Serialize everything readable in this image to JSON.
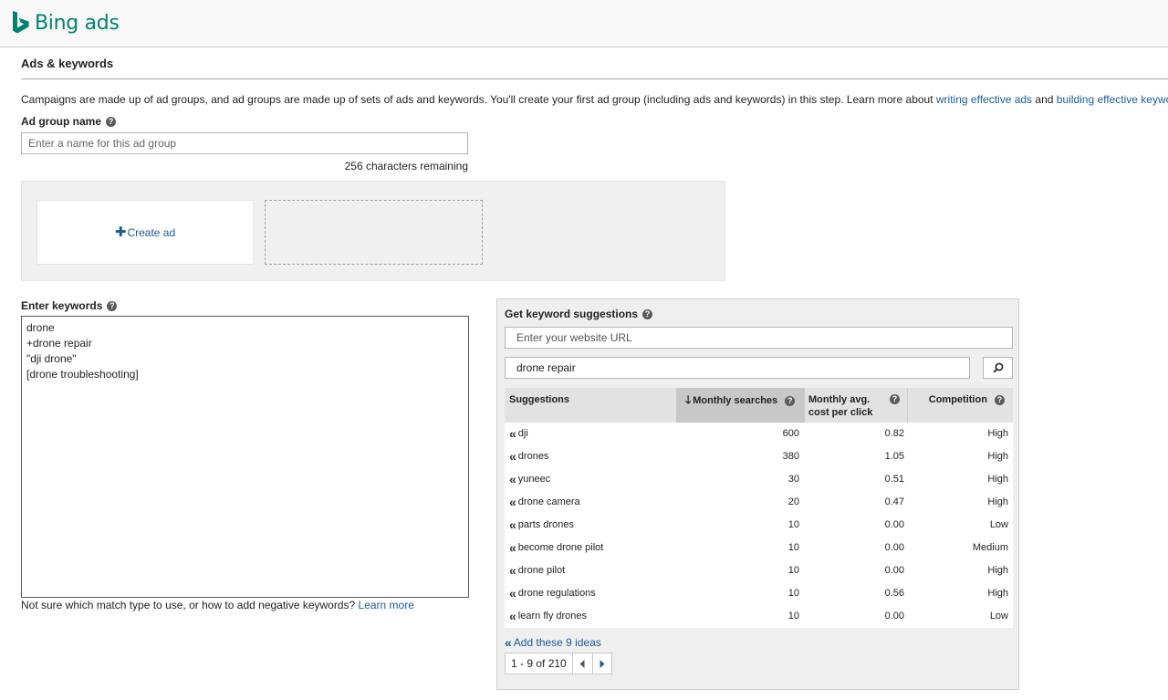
{
  "app": {
    "logo_text": "Bing ads"
  },
  "section_title": "Ads & keywords",
  "intro": {
    "text": "Campaigns are made up of ad groups, and ad groups are made up of sets of ads and keywords. You'll create your first ad group (including ads and keywords) in this step. Learn more about ",
    "link1": "writing effective ads",
    "and": " and ",
    "link2": "building effective keyword lists"
  },
  "ad_group": {
    "label": "Ad group name",
    "placeholder": "Enter a name for this ad group",
    "value": "",
    "chars_remaining": "256 characters remaining"
  },
  "ads": {
    "create_label": "Create ad"
  },
  "keywords": {
    "label": "Enter keywords",
    "value": "drone\n+drone repair\n\"dji drone\"\n[drone troubleshooting]",
    "help_text": "Not sure which match type to use, or how to add negative keywords? ",
    "help_link": "Learn more"
  },
  "suggestions": {
    "title": "Get keyword suggestions",
    "url_placeholder": "Enter your website URL",
    "search_value": "drone repair",
    "columns": {
      "suggestions": "Suggestions",
      "monthly": "Monthly searches",
      "cost_line1": "Monthly avg.",
      "cost_line2": "cost per click",
      "competition": "Competition"
    },
    "rows": [
      {
        "term": "dji",
        "monthly": "600",
        "cost": "0.82",
        "competition": "High"
      },
      {
        "term": "drones",
        "monthly": "380",
        "cost": "1.05",
        "competition": "High"
      },
      {
        "term": "yuneec",
        "monthly": "30",
        "cost": "0.51",
        "competition": "High"
      },
      {
        "term": "drone camera",
        "monthly": "20",
        "cost": "0.47",
        "competition": "High"
      },
      {
        "term": "parts drones",
        "monthly": "10",
        "cost": "0.00",
        "competition": "Low"
      },
      {
        "term": "become drone pilot",
        "monthly": "10",
        "cost": "0.00",
        "competition": "Medium"
      },
      {
        "term": "drone pilot",
        "monthly": "10",
        "cost": "0.00",
        "competition": "High"
      },
      {
        "term": "drone regulations",
        "monthly": "10",
        "cost": "0.56",
        "competition": "High"
      },
      {
        "term": "learn fly drones",
        "monthly": "10",
        "cost": "0.00",
        "competition": "Low"
      }
    ],
    "add_all": "Add these 9 ideas",
    "pager": "1 - 9 of 210"
  },
  "colors": {
    "brand": "#008272",
    "link": "#1a5b99",
    "panel_bg": "#efefef",
    "sorted_header": "#c8c8c8"
  }
}
